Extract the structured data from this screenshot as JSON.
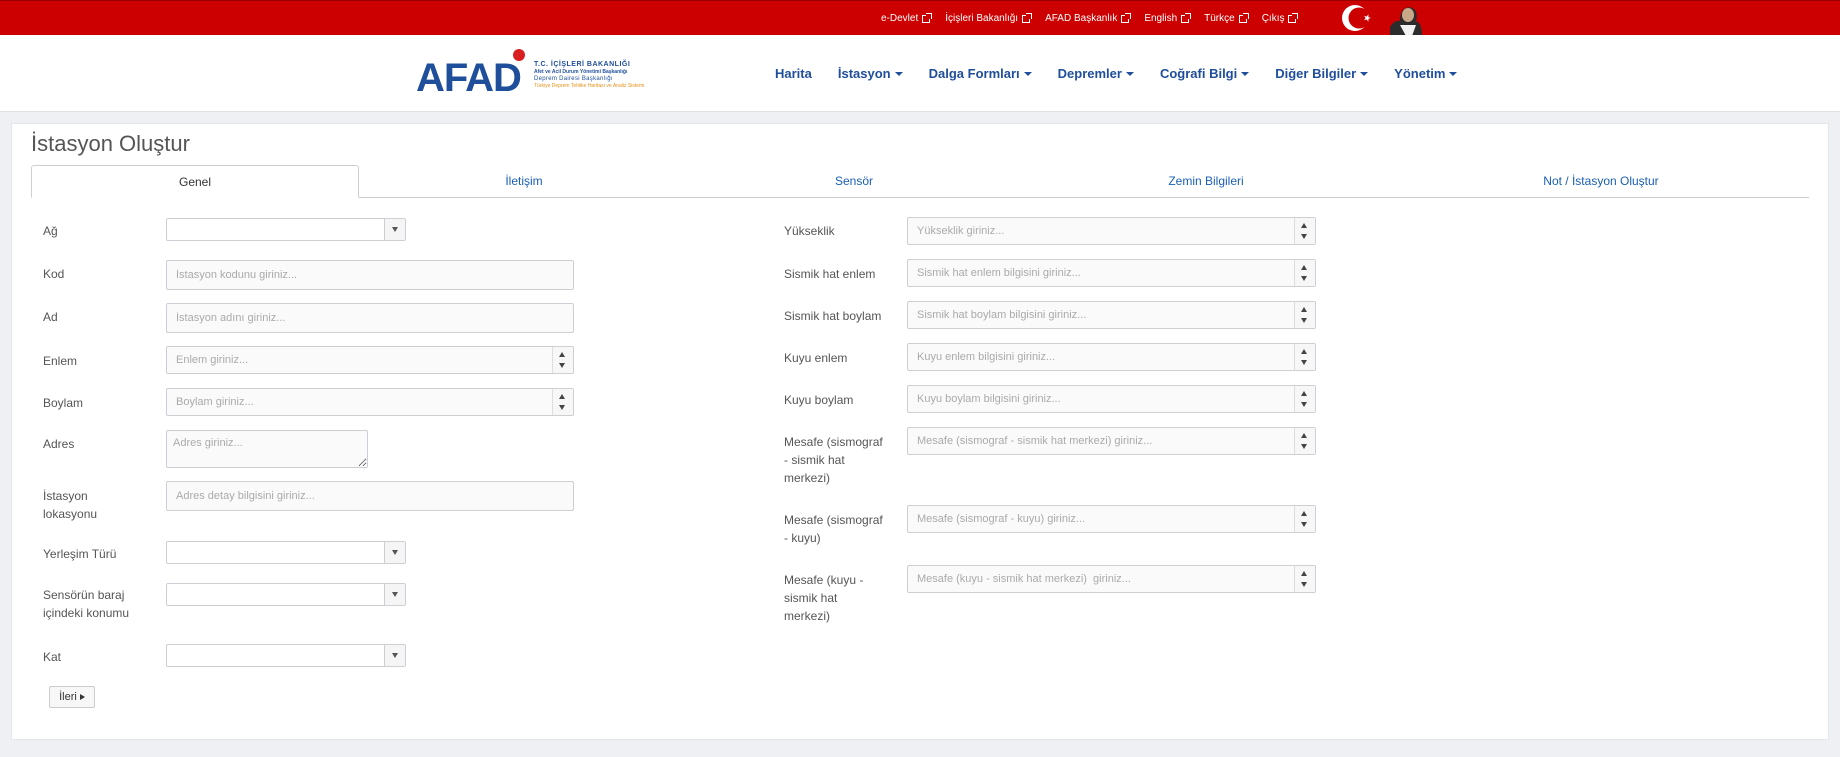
{
  "topbar": {
    "links": [
      "e-Devlet",
      "İçişleri Bakanlığı",
      "AFAD Başkanlık",
      "English",
      "Türkçe",
      "Çıkış"
    ],
    "colors": {
      "bar": "#cc0000"
    }
  },
  "logo": {
    "main": "AFAD",
    "line1": "T.C. İÇİŞLERİ BAKANLIĞI",
    "line2": "Afet ve Acil Durum Yönetimi Başkanlığı",
    "line3": "Deprem Dairesi Başkanlığı",
    "line4": "Türkiye Deprem Tehlike Haritası ve Analiz Sistemi"
  },
  "nav": {
    "items": [
      {
        "label": "Harita",
        "dropdown": false
      },
      {
        "label": "İstasyon",
        "dropdown": true
      },
      {
        "label": "Dalga Formları",
        "dropdown": true
      },
      {
        "label": "Depremler",
        "dropdown": true
      },
      {
        "label": "Coğrafi Bilgi",
        "dropdown": true
      },
      {
        "label": "Diğer Bilgiler",
        "dropdown": true
      },
      {
        "label": "Yönetim",
        "dropdown": true
      }
    ]
  },
  "page": {
    "title": "İstasyon Oluştur"
  },
  "tabs": [
    "Genel",
    "İletişim",
    "Sensör",
    "Zemin Bilgileri",
    "Not / İstasyon Oluştur"
  ],
  "form_left": {
    "ag": {
      "label": "Ağ",
      "value": ""
    },
    "kod": {
      "label": "Kod",
      "placeholder": "İstasyon kodunu giriniz..."
    },
    "ad": {
      "label": "Ad",
      "placeholder": "İstasyon adını giriniz..."
    },
    "enlem": {
      "label": "Enlem",
      "placeholder": "Enlem giriniz..."
    },
    "boylam": {
      "label": "Boylam",
      "placeholder": "Boylam giriniz..."
    },
    "adres": {
      "label": "Adres",
      "placeholder": "Adres giriniz..."
    },
    "lokasyon": {
      "label_1": "İstasyon",
      "label_2": "lokasyonu",
      "placeholder": "Adres detay bilgisini giriniz..."
    },
    "yerlesim": {
      "label": "Yerleşim Türü",
      "value": ""
    },
    "sensor_konum": {
      "label_1": "Sensörün baraj",
      "label_2": "içindeki konumu",
      "value": ""
    },
    "kat": {
      "label": "Kat",
      "value": ""
    }
  },
  "form_right": {
    "yukseklik": {
      "label": "Yükseklik",
      "placeholder": "Yükseklik giriniz..."
    },
    "sismik_enlem": {
      "label": "Sismik hat enlem",
      "placeholder": "Sismik hat enlem bilgisini giriniz..."
    },
    "sismik_boylam": {
      "label": "Sismik hat boylam",
      "placeholder": "Sismik hat boylam bilgisini giriniz..."
    },
    "kuyu_enlem": {
      "label": "Kuyu enlem",
      "placeholder": "Kuyu enlem bilgisini giriniz..."
    },
    "kuyu_boylam": {
      "label": "Kuyu boylam",
      "placeholder": "Kuyu boylam bilgisini giriniz..."
    },
    "mesafe_sism_hat": {
      "label_1": "Mesafe (sismograf",
      "label_2": "- sismik hat",
      "label_3": "merkezi)",
      "placeholder": "Mesafe (sismograf - sismik hat merkezi) giriniz..."
    },
    "mesafe_sism_kuyu": {
      "label_1": "Mesafe (sismograf",
      "label_2": "- kuyu)",
      "placeholder": "Mesafe (sismograf - kuyu) giriniz..."
    },
    "mesafe_kuyu_hat": {
      "label_1": "Mesafe (kuyu -",
      "label_2": "sismik hat",
      "label_3": "merkezi)",
      "placeholder": "Mesafe (kuyu - sismik hat merkezi)  giriniz..."
    }
  },
  "buttons": {
    "next": "İleri"
  }
}
